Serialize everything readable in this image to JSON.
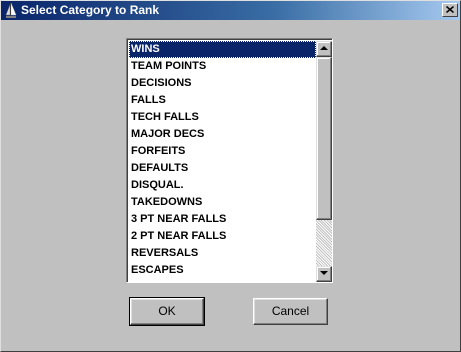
{
  "window": {
    "title": "Select Category to Rank"
  },
  "icons": {
    "app": "sailboat-icon",
    "close": "close-icon",
    "scroll_up": "arrow-up-icon",
    "scroll_down": "arrow-down-icon"
  },
  "list": {
    "selected_index": 0,
    "items": [
      "WINS",
      "TEAM POINTS",
      "DECISIONS",
      "FALLS",
      "TECH FALLS",
      "MAJOR DECS",
      "FORFEITS",
      "DEFAULTS",
      "DISQUAL.",
      "TAKEDOWNS",
      "3 PT NEAR FALLS",
      "2 PT NEAR FALLS",
      "REVERSALS",
      "ESCAPES"
    ]
  },
  "buttons": {
    "ok": "OK",
    "cancel": "Cancel"
  },
  "colors": {
    "titlebar_start": "#0a246a",
    "titlebar_end": "#a6caf0",
    "selection": "#0a246a",
    "face": "#c0c0c0"
  }
}
